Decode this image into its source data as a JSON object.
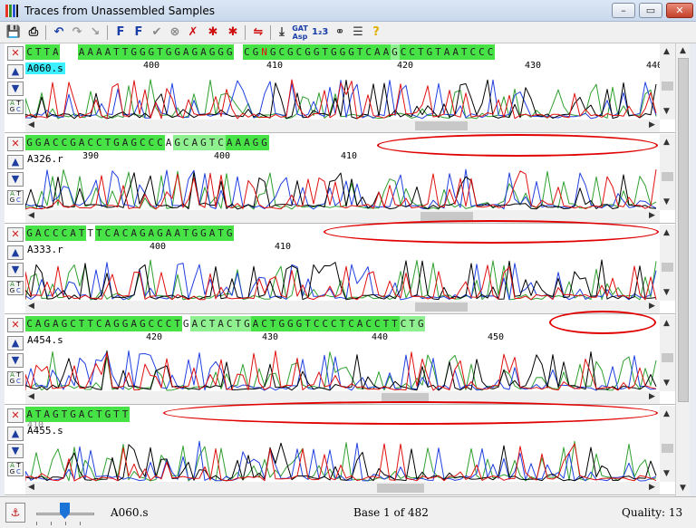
{
  "window": {
    "title": "Traces from Unassembled Samples"
  },
  "toolbar": {
    "items": [
      "save-icon",
      "print-icon",
      "undo-icon",
      "redo-icon",
      "redo-alt-icon",
      "first-f-icon",
      "forward-f-icon",
      "checkmark-icon",
      "cancel-icon",
      "trace-x-icon",
      "prev-star-icon",
      "next-star-icon",
      "swap-icon",
      "zoom-icon",
      "gat-asp-icon",
      "numbering-icon",
      "link-icon",
      "list-icon",
      "help-icon"
    ]
  },
  "traces": [
    {
      "name": "A060.s",
      "selected": true,
      "sequence": "CTTA  AAAATTGGGTGGAGAGGG CGNGCGCGGTGGGTCAAGCCTGTAATCCC",
      "ticks": [
        "400",
        "410",
        "420",
        "430",
        "440"
      ],
      "colors": [
        "hi",
        "hi",
        "hi",
        "hi",
        "no",
        "no",
        "hi",
        "hi",
        "hi",
        "hi",
        "hi",
        "hi",
        "hi",
        "hi",
        "hi",
        "hi",
        "hi",
        "hi",
        "hi",
        "hi",
        "hi",
        "hi",
        "hi",
        "hi",
        "no",
        "hi",
        "hi",
        "hi",
        "hi",
        "hi",
        "hi",
        "hi",
        "hi",
        "hi",
        "hi",
        "hi",
        "hi",
        "hi",
        "hi",
        "hi",
        "hi",
        "hi",
        "lo",
        "hi",
        "hi",
        "hi",
        "hi",
        "hi",
        "hi",
        "hi",
        "hi",
        "hi",
        "hi",
        "hi",
        "hi",
        "hi",
        "hi"
      ]
    },
    {
      "name": "A326.r",
      "selected": false,
      "sequence": "GGACCGACCTGAGCCCAGCAGTCAAAGG",
      "ticks": [
        "390",
        "400",
        "410"
      ],
      "colors": [
        "hi",
        "hi",
        "hi",
        "hi",
        "hi",
        "hi",
        "hi",
        "hi",
        "hi",
        "hi",
        "hi",
        "hi",
        "hi",
        "hi",
        "hi",
        "hi",
        "no",
        "lo",
        "lo",
        "lo",
        "lo",
        "lo",
        "lo",
        "hi",
        "hi",
        "hi",
        "hi",
        "hi"
      ]
    },
    {
      "name": "A333.r",
      "selected": false,
      "sequence": "GACCCATTTCACAGAGAATGGATG",
      "ticks": [
        "400",
        "410"
      ],
      "colors": [
        "hi",
        "hi",
        "hi",
        "hi",
        "hi",
        "hi",
        "hi",
        "no",
        "hi",
        "hi",
        "hi",
        "hi",
        "hi",
        "hi",
        "hi",
        "hi",
        "hi",
        "hi",
        "hi",
        "hi",
        "hi",
        "hi",
        "hi",
        "hi"
      ]
    },
    {
      "name": "A454.s",
      "selected": false,
      "sequence": "CAGAGCTTCAGGAGCCCTGACTACTGACTGGGTCCCTCACCTTCTG",
      "ticks": [
        "420",
        "430",
        "440",
        "450"
      ],
      "colors": [
        "hi",
        "hi",
        "hi",
        "hi",
        "hi",
        "hi",
        "hi",
        "hi",
        "hi",
        "hi",
        "hi",
        "hi",
        "hi",
        "hi",
        "hi",
        "hi",
        "hi",
        "hi",
        "no",
        "lo",
        "lo",
        "lo",
        "lo",
        "lo",
        "lo",
        "lo",
        "hi",
        "hi",
        "hi",
        "hi",
        "hi",
        "hi",
        "hi",
        "hi",
        "hi",
        "hi",
        "hi",
        "hi",
        "hi",
        "hi",
        "hi",
        "hi",
        "hi",
        "lo",
        "lo",
        "lo"
      ]
    },
    {
      "name": "A455.s",
      "selected": false,
      "sequence": "ATAGTGACTGTT",
      "ticks": [
        "410"
      ],
      "colors": [
        "hi",
        "hi",
        "hi",
        "hi",
        "hi",
        "hi",
        "hi",
        "hi",
        "hi",
        "hi",
        "hi",
        "hi"
      ]
    }
  ],
  "status": {
    "sample": "A060.s",
    "base": "Base 1 of 482",
    "quality": "Quality: 13"
  }
}
